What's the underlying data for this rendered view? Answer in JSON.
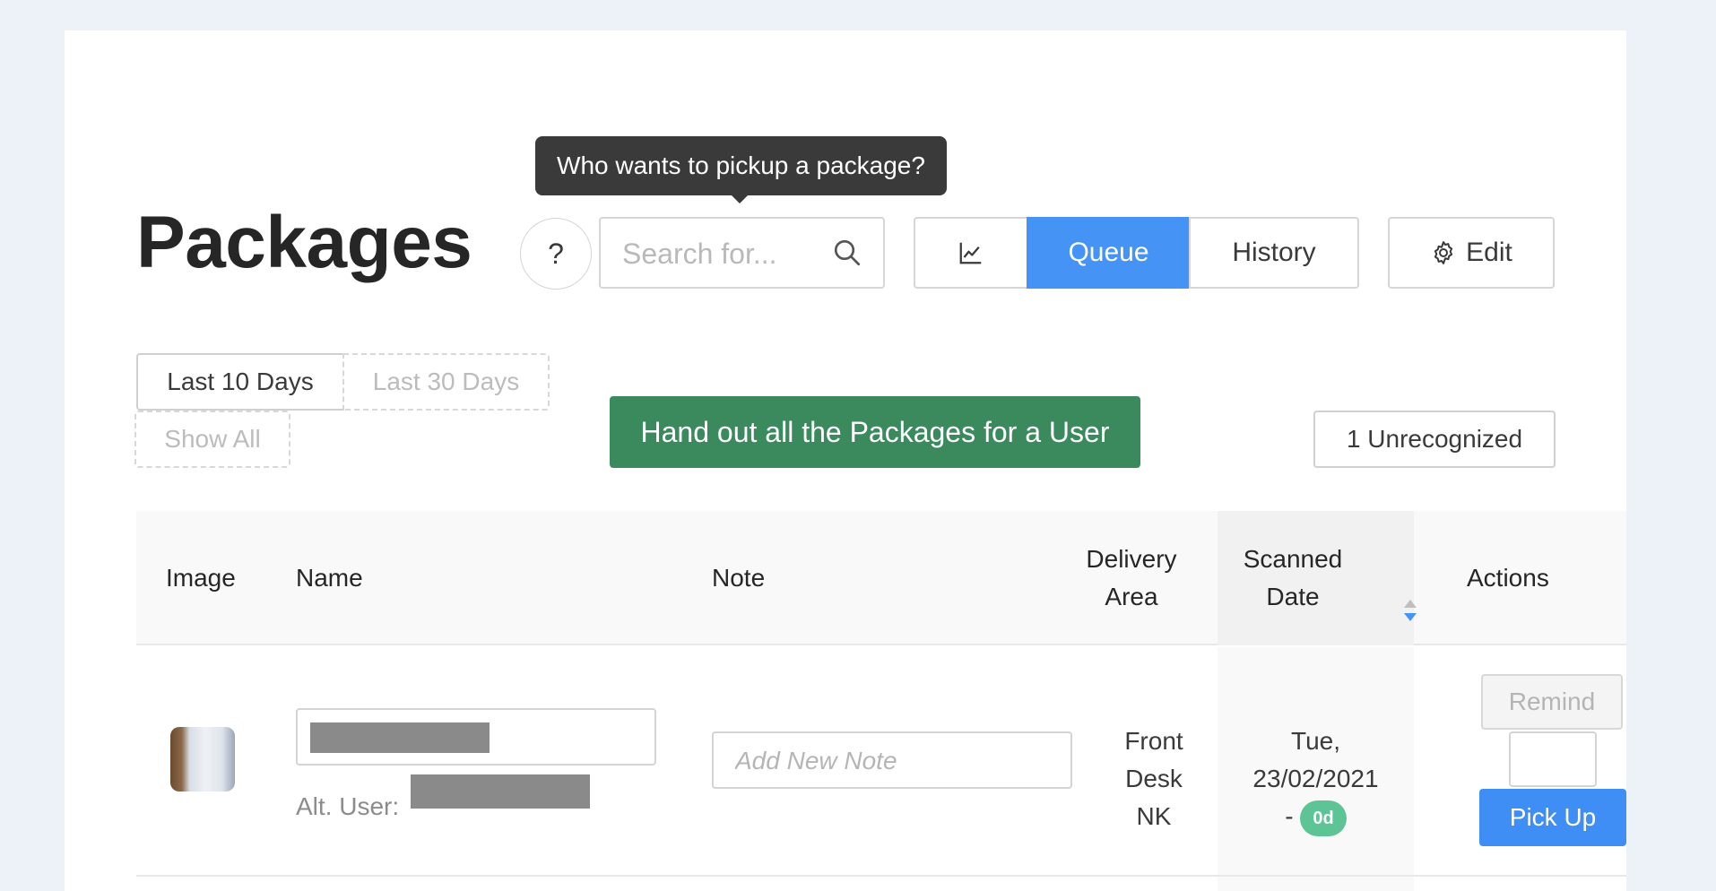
{
  "page": {
    "title": "Packages"
  },
  "tooltip": {
    "text": "Who wants to pickup a package?"
  },
  "toolbar": {
    "help_label": "?",
    "search_placeholder": "Search for...",
    "tabs": [
      {
        "label": "",
        "icon": "line-chart-icon",
        "active": false
      },
      {
        "label": "Queue",
        "active": true
      },
      {
        "label": "History",
        "active": false
      }
    ],
    "edit_label": "Edit",
    "edit_icon": "gear-icon"
  },
  "filters": {
    "ranges": [
      {
        "label": "Last 10 Days",
        "active": true
      },
      {
        "label": "Last 30 Days",
        "active": false
      },
      {
        "label": "Show All",
        "active": false
      }
    ]
  },
  "actions": {
    "handout_label": "Hand out all the Packages for a User",
    "unrecognized_label": "1 Unrecognized"
  },
  "table": {
    "columns": [
      "Image",
      "Name",
      "Note",
      "Delivery Area",
      "Scanned Date",
      "Actions"
    ],
    "column_lines": {
      "delivery_area": [
        "Delivery",
        "Area"
      ],
      "scanned_date": [
        "Scanned",
        "Date"
      ]
    },
    "rows": [
      {
        "alt_user_label": "Alt. User:",
        "note_placeholder": "Add New Note",
        "delivery_area_lines": [
          "Front",
          "Desk",
          "NK"
        ],
        "scanned_date_line1": "Tue,",
        "scanned_date_line2": "23/02/2021",
        "scanned_date_dash": "-",
        "age_badge": "0d",
        "remind_label": "Remind",
        "pickup_label": "Pick Up"
      }
    ]
  },
  "colors": {
    "accent_blue": "#4593f5",
    "handout_green": "#3a8a5e",
    "badge_green": "#5cc495",
    "page_bg": "#edf1f8"
  }
}
